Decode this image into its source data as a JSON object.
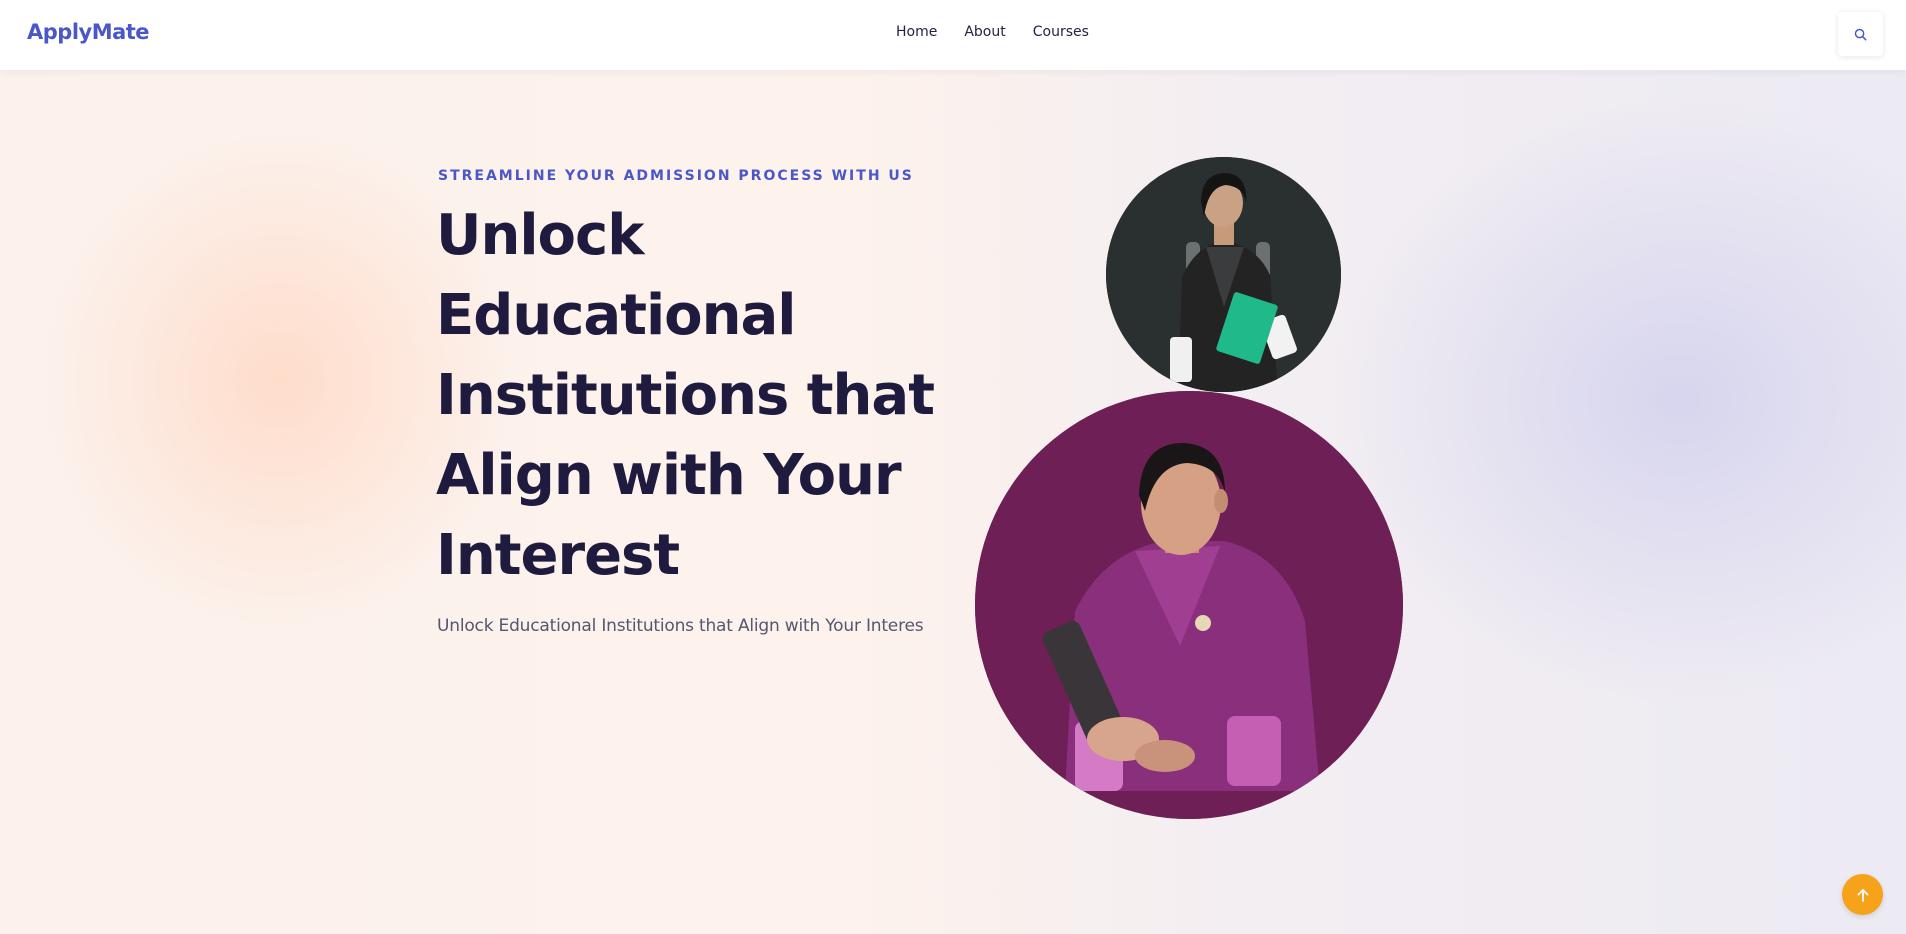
{
  "header": {
    "logo": "ApplyMate",
    "nav": [
      {
        "label": "Home"
      },
      {
        "label": "About"
      },
      {
        "label": "Courses"
      }
    ],
    "search_icon": "search-icon"
  },
  "hero": {
    "eyebrow": "STREAMLINE YOUR ADMISSION PROCESS WITH US",
    "title": "Unlock Educational Institutions that Align with Your Interest",
    "subtitle": "Unlock Educational Institutions that Align with Your Interes",
    "images": [
      {
        "name": "student-small-photo"
      },
      {
        "name": "student-large-photo"
      }
    ]
  },
  "back_to_top_icon": "arrow-up-icon",
  "colors": {
    "brand": "#4a57c9",
    "heading": "#1e1b3e",
    "accent_orange": "#f7a21b",
    "small_circle_bg": "#2a3030",
    "large_circle_bg": "#6e1f55"
  }
}
